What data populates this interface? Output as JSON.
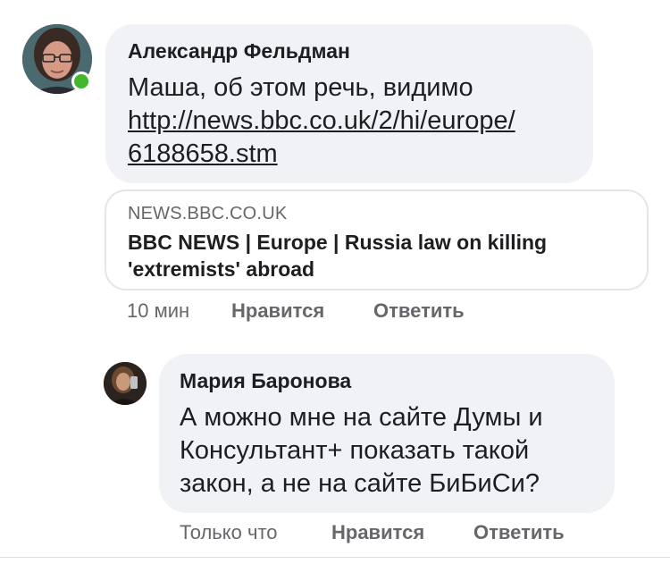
{
  "comments": [
    {
      "author": "Александр Фельдман",
      "text": "Маша, об этом речь, видимо",
      "link_line1": "http://news.bbc.co.uk/2/hi/europe/",
      "link_line2": "6188658.stm",
      "online": true,
      "preview": {
        "domain": "NEWS.BBC.CO.UK",
        "title": "BBC NEWS | Europe | Russia law on killing 'extremists' abroad"
      },
      "time": "10 мин",
      "like_label": "Нравится",
      "reply_label": "Ответить"
    },
    {
      "author": "Мария Баронова",
      "text": "А можно мне на сайте Думы и Консультант+ показать такой закон, а не на сайте БиБиСи?",
      "time": "Только что",
      "like_label": "Нравится",
      "reply_label": "Ответить"
    }
  ],
  "colors": {
    "bubble": "#f0f2f5",
    "secondary_text": "#65676b",
    "primary_text": "#1c1e21",
    "online": "#42b72a"
  }
}
